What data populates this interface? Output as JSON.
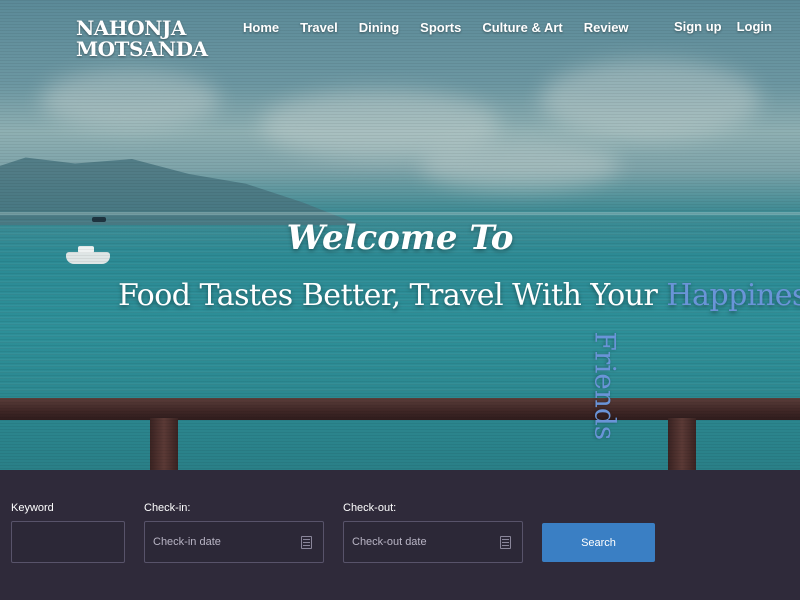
{
  "brand": {
    "line1": "NAHONJA",
    "line2": "MOTSANDA"
  },
  "nav": {
    "items": [
      {
        "label": "Home"
      },
      {
        "label": "Travel"
      },
      {
        "label": "Dining"
      },
      {
        "label": "Sports"
      },
      {
        "label": "Culture & Art"
      },
      {
        "label": "Review"
      }
    ]
  },
  "auth": {
    "signup_label": "Sign up",
    "login_label": "Login"
  },
  "hero": {
    "welcome": "Welcome To",
    "tagline_main": "Food Tastes Better, Travel With Your",
    "tagline_accent": "Happiness",
    "tagline_vertical": "Friends",
    "accent_color": "#6a94d8"
  },
  "search": {
    "keyword_label": "Keyword",
    "keyword_value": "",
    "checkin_label": "Check-in:",
    "checkin_placeholder": "Check-in date",
    "checkout_label": "Check-out:",
    "checkout_placeholder": "Check-out date",
    "button_label": "Search",
    "button_color": "#3a7fc4",
    "calendar_icon": "calendar-icon"
  }
}
